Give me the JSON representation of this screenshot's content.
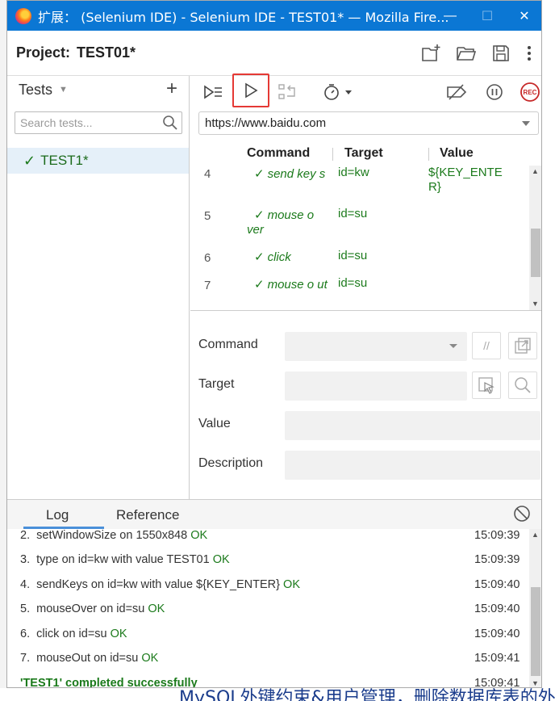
{
  "window": {
    "title": "扩展：  (Selenium IDE) - Selenium IDE - TEST01* — Mozilla Fire...",
    "controls": {
      "minimize": "—",
      "maximize": "☐",
      "close": "✕"
    }
  },
  "project": {
    "label": "Project:",
    "name": "TEST01*"
  },
  "tests": {
    "header": "Tests",
    "add": "+",
    "search_placeholder": "Search tests...",
    "items": [
      {
        "check": "✓",
        "name": "TEST1*"
      }
    ]
  },
  "url": "https://www.baidu.com",
  "grid": {
    "headers": {
      "command": "Command",
      "target": "Target",
      "value": "Value"
    },
    "rows": [
      {
        "index": "4",
        "command": "send key s",
        "target": "id=kw",
        "value": "${KEY_ENTER}"
      },
      {
        "index": "5",
        "command": "mouse o ver",
        "target": "id=su",
        "value": ""
      },
      {
        "index": "6",
        "command": "click",
        "target": "id=su",
        "value": ""
      },
      {
        "index": "7",
        "command": "mouse o ut",
        "target": "id=su",
        "value": ""
      }
    ]
  },
  "form": {
    "command_label": "Command",
    "target_label": "Target",
    "value_label": "Value",
    "description_label": "Description",
    "comment_button": "//"
  },
  "log": {
    "tabs": {
      "log": "Log",
      "reference": "Reference"
    },
    "lines": [
      {
        "n": "2.",
        "text": "setWindowSize on 1550x848",
        "status": "OK",
        "time": "15:09:39"
      },
      {
        "n": "3.",
        "text": "type on id=kw with value TEST01",
        "status": "OK",
        "time": "15:09:39"
      },
      {
        "n": "4.",
        "text": "sendKeys on id=kw with value ${KEY_ENTER}",
        "status": "OK",
        "time": "15:09:40"
      },
      {
        "n": "5.",
        "text": "mouseOver on id=su",
        "status": "OK",
        "time": "15:09:40"
      },
      {
        "n": "6.",
        "text": "click on id=su",
        "status": "OK",
        "time": "15:09:40"
      },
      {
        "n": "7.",
        "text": "mouseOut on id=su",
        "status": "OK",
        "time": "15:09:41"
      }
    ],
    "final": {
      "text": "'TEST1' completed successfully",
      "time": "15:09:41"
    }
  },
  "background": {
    "bottom_text": "MySQL外键约束&用户管理，删除数据库表的外"
  },
  "colors": {
    "titlebar": "#0b77d4",
    "ok_green": "#1b7a1b",
    "highlight_red": "#e53935",
    "selected_row": "#e5f0f9"
  }
}
